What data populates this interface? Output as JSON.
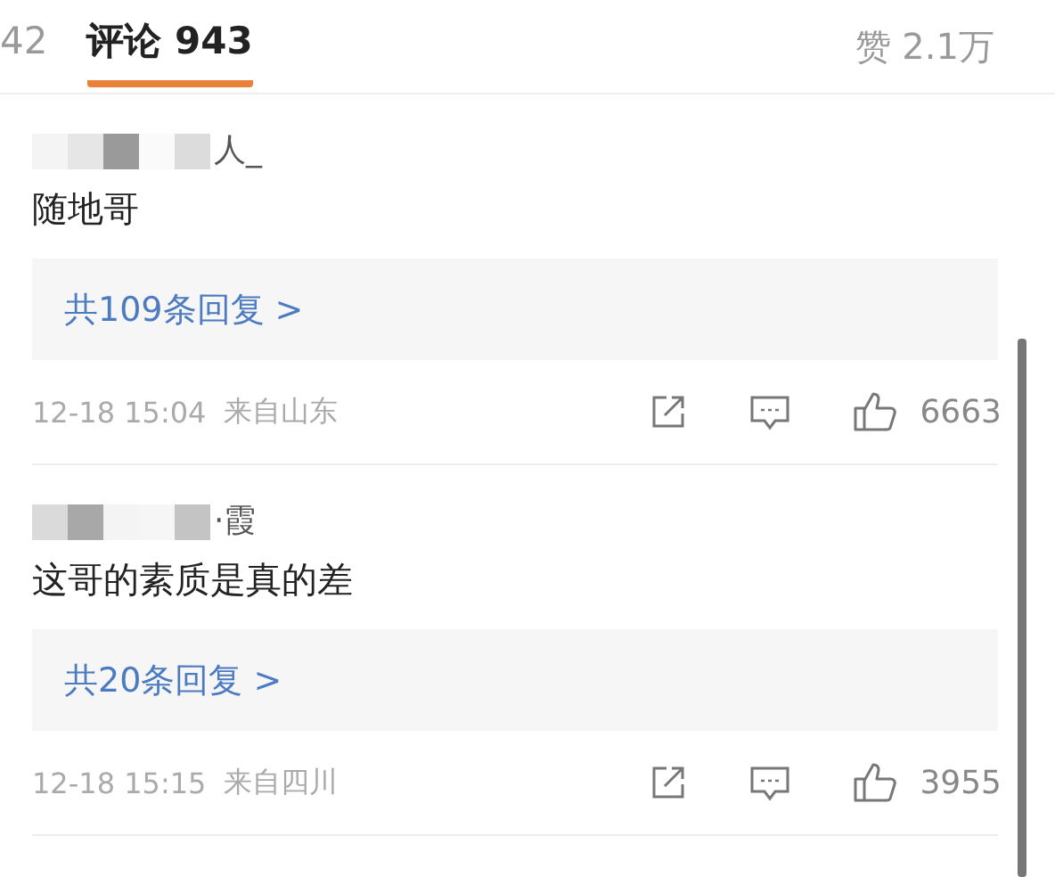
{
  "tabs": [
    {
      "label": "42",
      "selected": false
    },
    {
      "label": "评论 943",
      "selected": true
    }
  ],
  "like_total": "赞 2.1万",
  "comments": [
    {
      "username_visible": "人_",
      "text": "随地哥",
      "replies": "共109条回复 >",
      "time": "12-18 15:04",
      "location": "来自山东",
      "likes": "6663"
    },
    {
      "username_visible": "·霞",
      "text": "这哥的素质是真的差",
      "replies": "共20条回复 >",
      "time": "12-18 15:15",
      "location": "来自四川",
      "likes": "3955"
    }
  ]
}
